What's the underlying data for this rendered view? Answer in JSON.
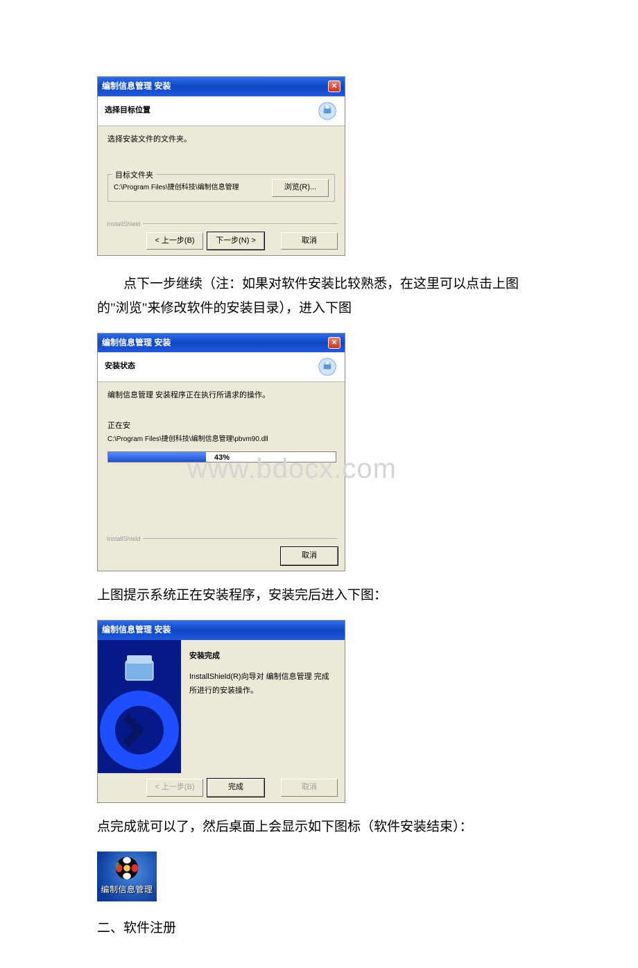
{
  "dialog1": {
    "title": "编制信息管理 安装",
    "heading": "选择目标位置",
    "body_text": "选择安装文件的文件夹。",
    "fieldset_label": "目标文件夹",
    "path": "C:\\Program Files\\捷创科技\\编制信息管理",
    "browse_btn": "浏览(R)...",
    "shield": "InstallShield",
    "back_btn": "< 上一步(B)",
    "next_btn": "下一步(N) >",
    "cancel_btn": "取消"
  },
  "para1": "点下一步继续（注：如果对软件安装比较熟悉，在这里可以点击上图的\"浏览\"来修改软件的安装目录），进入下图",
  "dialog2": {
    "title": "编制信息管理 安装",
    "heading": "安装状态",
    "status_line": "编制信息管理 安装程序正在执行所请求的操作。",
    "installing_label": "正在安",
    "file_path": "C:\\Program Files\\捷创科技\\编制信息管理\\pbvm90.dll",
    "progress_text": "43%",
    "shield": "InstallShield",
    "cancel_btn": "取消"
  },
  "watermark": "www.bdocx.com",
  "para2": "上图提示系统正在安装程序，安装完后进入下图：",
  "dialog3": {
    "title": "编制信息管理 安装",
    "heading": "安装完成",
    "body_text": "InstallShield(R)向导对 编制信息管理 完成所进行的安装操作。",
    "back_btn": "< 上一步(B)",
    "finish_btn": "完成",
    "cancel_btn": "取消"
  },
  "para3": "点完成就可以了，然后桌面上会显示如下图标（软件安装结束）：",
  "desktop_icon": {
    "label": "编制信息管理"
  },
  "section2": "二、软件注册"
}
